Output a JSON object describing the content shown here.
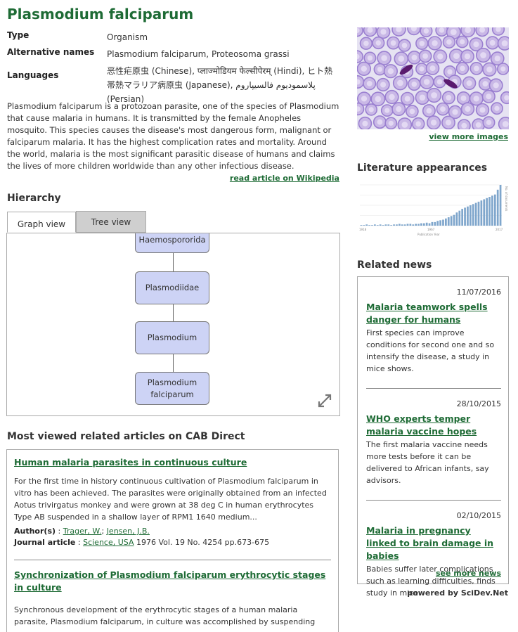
{
  "page": {
    "title": "Plasmodium falciparum"
  },
  "info": {
    "type_label": "Type",
    "type_value": "Organism",
    "alt_label": "Alternative names",
    "alt_value": "Plasmodium falciparum, Proteosoma grassi",
    "lang_label": "Languages",
    "lang_value": "恶性疟原虫 (Chinese), प्लाज्मोडियम फेल्सीपेरम् (Hindi), ヒト熱帯熱マラリア病原虫 (Japanese), پلاسمودیوم فالسیپاروم (Persian)"
  },
  "description": "Plasmodium falciparum is a protozoan parasite, one of the species of Plasmodium that cause malaria in humans. It is transmitted by the female Anopheles mosquito. This species causes the disease's most dangerous form, malignant or falciparum malaria. It has the highest complication rates and mortality. Around the world, malaria is the most significant parasitic disease of humans and claims the lives of more children worldwide than any other infectious disease.",
  "wiki_link": "read article on Wikipedia",
  "hierarchy": {
    "heading": "Hierarchy",
    "tabs": [
      "Graph view",
      "Tree view"
    ],
    "nodes": [
      "Haemospororida",
      "Plasmodiidae",
      "Plasmodium",
      "Plasmodium falciparum"
    ]
  },
  "articles": {
    "heading": "Most viewed related articles on CAB Direct",
    "items": [
      {
        "title": "Human malaria parasites in continuous culture",
        "body": "For the first time in history continuous cultivation of Plasmodium falciparum in vitro has been achieved. The parasites were originally obtained from an infected Aotus trivirgatus monkey and were grown at 38 deg C in human erythrocytes Type AB suspended in a shallow layer of RPM1 1640 medium...",
        "authors_label": "Author(s)",
        "author1": "Trager, W.",
        "author2": "Jensen, J.B.",
        "journal_label": "Journal article",
        "journal": "Science, USA",
        "journal_rest": "1976 Vol. 19 No. 4254 pp.673-675"
      },
      {
        "title": "Synchronization of Plasmodium falciparum erythrocytic stages in culture",
        "body": "Synchronous development of the erythrocytic stages of a human malaria parasite, Plasmodium falciparum, in culture was accomplished by suspending"
      }
    ]
  },
  "images": {
    "more_link": "view more images"
  },
  "literature": {
    "heading": "Literature appearances",
    "y_label": "No. of documents",
    "x_label": "Publication Year",
    "x_ticks": [
      "1918",
      "1967",
      "2017"
    ]
  },
  "chart_data": {
    "type": "bar",
    "title": "",
    "xlabel": "Publication Year",
    "ylabel": "No. of documents",
    "values": [
      1,
      1,
      2,
      1,
      1,
      2,
      1,
      2,
      1,
      2,
      2,
      1,
      2,
      2,
      3,
      2,
      2,
      3,
      3,
      2,
      3,
      3,
      4,
      4,
      5,
      4,
      6,
      6,
      8,
      9,
      10,
      12,
      14,
      16,
      18,
      22,
      25,
      28,
      30,
      32,
      34,
      36,
      38,
      40,
      42,
      44,
      46,
      48,
      50,
      52,
      60,
      68
    ]
  },
  "news": {
    "heading": "Related news",
    "items": [
      {
        "date": "11/07/2016",
        "title": "Malaria teamwork spells danger for humans",
        "body": "First species can improve conditions for second one and so intensify the disease, a study in mice shows."
      },
      {
        "date": "28/10/2015",
        "title": "WHO experts temper malaria vaccine hopes",
        "body": "The first malaria vaccine needs more tests before it can be delivered to African infants, say advisors."
      },
      {
        "date": "02/10/2015",
        "title": "Malaria in pregnancy linked to brain damage in babies",
        "body": "Babies suffer later complications such as learning difficulties, finds study in mice."
      }
    ],
    "see_more": "see more news"
  },
  "powered_by": "powered by SciDev.Net"
}
